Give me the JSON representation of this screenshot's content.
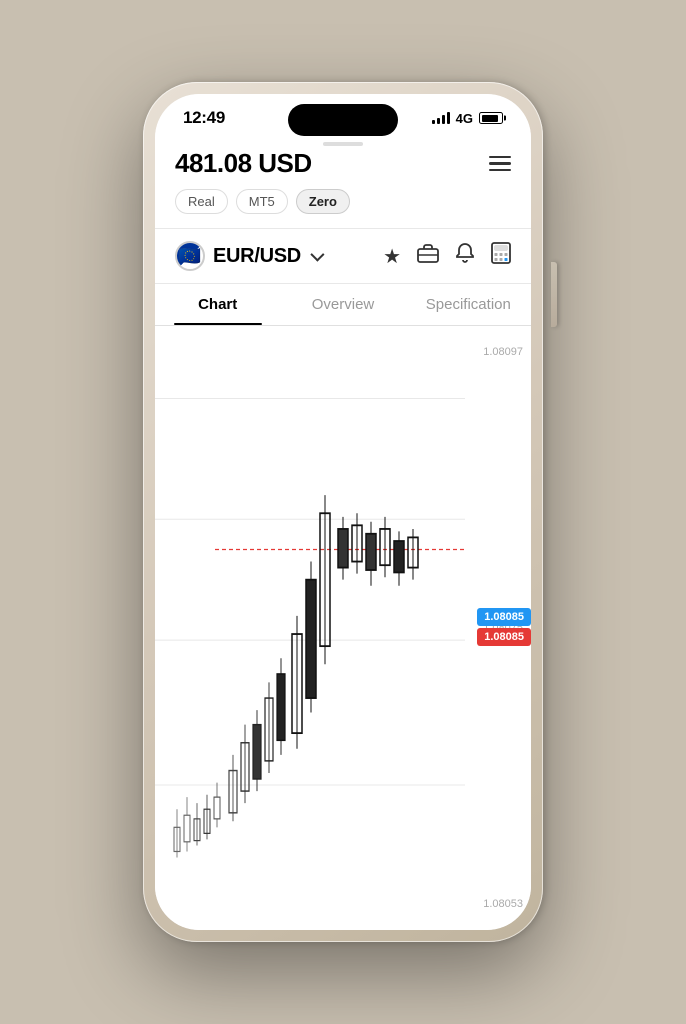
{
  "status_bar": {
    "time": "12:49",
    "network": "4G"
  },
  "header": {
    "balance": "481.08 USD",
    "menu_icon": "hamburger",
    "tags": [
      {
        "label": "Real",
        "active": false
      },
      {
        "label": "MT5",
        "active": false
      },
      {
        "label": "Zero",
        "active": true
      }
    ]
  },
  "pair": {
    "symbol": "EUR/USD",
    "flag_emoji": "🇪🇺"
  },
  "tabs": [
    {
      "label": "Chart",
      "active": true
    },
    {
      "label": "Overview",
      "active": false
    },
    {
      "label": "Specification",
      "active": false
    }
  ],
  "chart": {
    "price_high": "1.08097",
    "price_mid_high": "1.08085",
    "price_mid": "1.08075",
    "price_low": "1.08053",
    "current_bid": "1.08085",
    "current_ask": "1.08085"
  },
  "actions": {
    "star": "★",
    "briefcase": "💼",
    "bell": "🔔",
    "calculator": "🖩"
  }
}
